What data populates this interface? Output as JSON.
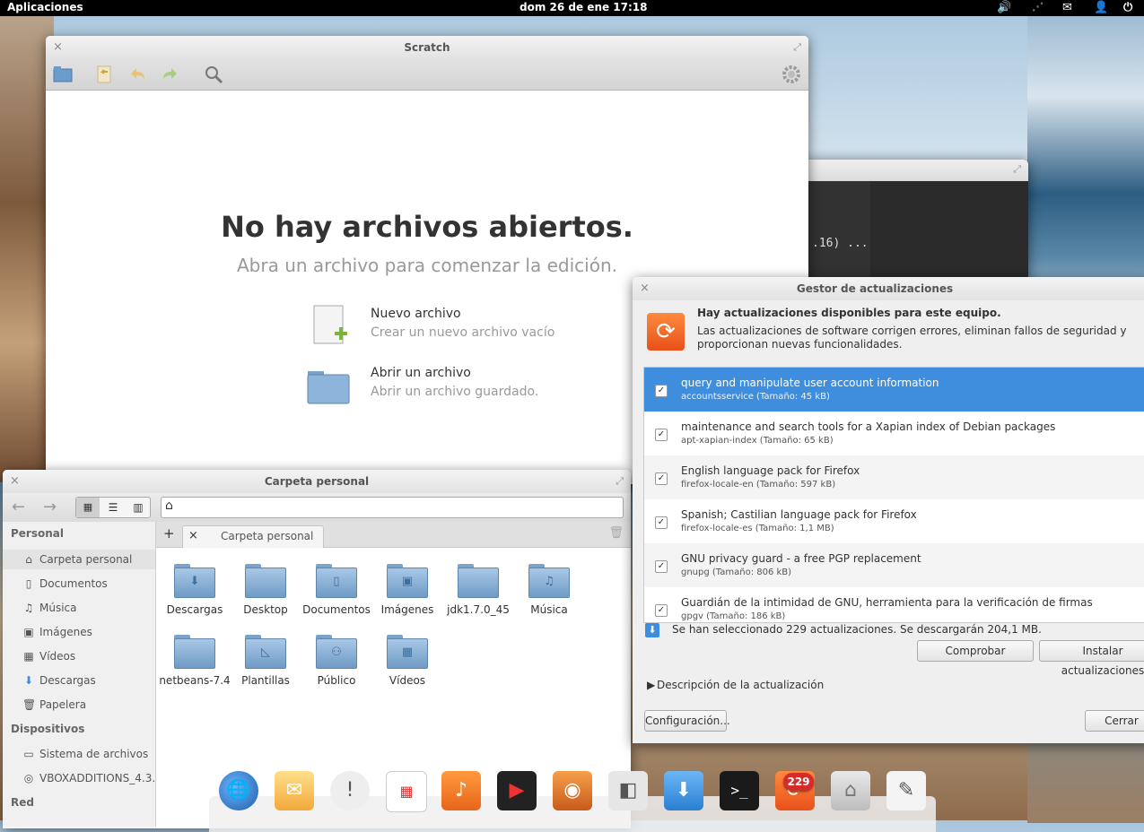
{
  "top_panel": {
    "apps_label": "Aplicaciones",
    "clock": "dom 26 de ene 17:18"
  },
  "scratch": {
    "title": "Scratch",
    "no_files_title": "No hay archivos abiertos.",
    "no_files_sub": "Abra un archivo para comenzar la edición.",
    "new_file_title": "Nuevo archivo",
    "new_file_desc": "Crear un nuevo archivo vacío",
    "open_file_title": "Abrir un archivo",
    "open_file_desc": "Abrir un archivo guardado."
  },
  "terminal": {
    "output_fragment": ".16) ..."
  },
  "files": {
    "title": "Carpeta personal",
    "tab_label": "Carpeta personal",
    "sidebar": {
      "personal_header": "Personal",
      "items": [
        {
          "label": "Carpeta personal",
          "icon": "home-icon"
        },
        {
          "label": "Documentos",
          "icon": "document-icon"
        },
        {
          "label": "Música",
          "icon": "music-icon"
        },
        {
          "label": "Imágenes",
          "icon": "image-icon"
        },
        {
          "label": "Vídeos",
          "icon": "video-icon"
        },
        {
          "label": "Descargas",
          "icon": "download-icon"
        },
        {
          "label": "Papelera",
          "icon": "trash-icon"
        }
      ],
      "devices_header": "Dispositivos",
      "devices": [
        {
          "label": "Sistema de archivos",
          "icon": "drive-icon"
        },
        {
          "label": "VBOXADDITIONS_4.3....",
          "icon": "disc-icon"
        }
      ],
      "network_header": "Red"
    },
    "folders": [
      {
        "label": "Descargas",
        "symbol": "⬇"
      },
      {
        "label": "Desktop",
        "symbol": ""
      },
      {
        "label": "Documentos",
        "symbol": "▯"
      },
      {
        "label": "Imágenes",
        "symbol": "▣"
      },
      {
        "label": "jdk1.7.0_45",
        "symbol": ""
      },
      {
        "label": "Música",
        "symbol": "♫"
      },
      {
        "label": "netbeans-7.4",
        "symbol": ""
      },
      {
        "label": "Plantillas",
        "symbol": "◺"
      },
      {
        "label": "Público",
        "symbol": "⚇"
      },
      {
        "label": "Vídeos",
        "symbol": "▦"
      }
    ]
  },
  "updates": {
    "title": "Gestor de actualizaciones",
    "heading": "Hay actualizaciones disponibles para este equipo.",
    "description": "Las actualizaciones de software corrigen errores, eliminan fallos de seguridad y proporcionan nuevas funcionalidades.",
    "packages": [
      {
        "name": "query and manipulate user account information",
        "size": "accountsservice (Tamaño: 45 kB)",
        "checked": true,
        "selected": true
      },
      {
        "name": "maintenance and search tools for a Xapian index of Debian packages",
        "size": "apt-xapian-index (Tamaño: 65 kB)",
        "checked": true
      },
      {
        "name": "English language pack for Firefox",
        "size": "firefox-locale-en (Tamaño: 597 kB)",
        "checked": true
      },
      {
        "name": "Spanish; Castilian language pack for Firefox",
        "size": "firefox-locale-es (Tamaño: 1,1 MB)",
        "checked": true
      },
      {
        "name": "GNU privacy guard - a free PGP replacement",
        "size": "gnupg (Tamaño: 806 kB)",
        "checked": true
      },
      {
        "name": "Guardián de la intimidad de GNU, herramienta para la verificación de firmas",
        "size": "gpgv (Tamaño: 186 kB)",
        "checked": true
      }
    ],
    "summary": "Se han seleccionado 229 actualizaciones. Se descargarán 204,1 MB.",
    "check_button": "Comprobar",
    "install_button": "Instalar actualizaciones",
    "details_toggle": "Descripción de la actualización",
    "settings_button": "Configuración...",
    "close_button": "Cerrar"
  },
  "dock": {
    "badge_count": "229",
    "items": [
      "browser-icon",
      "mail-icon",
      "notification-icon",
      "calendar-icon",
      "music-player-icon",
      "video-player-icon",
      "photos-icon",
      "settings-switch-icon",
      "download-icon",
      "terminal-icon",
      "update-manager-icon",
      "files-icon",
      "text-editor-icon"
    ]
  }
}
